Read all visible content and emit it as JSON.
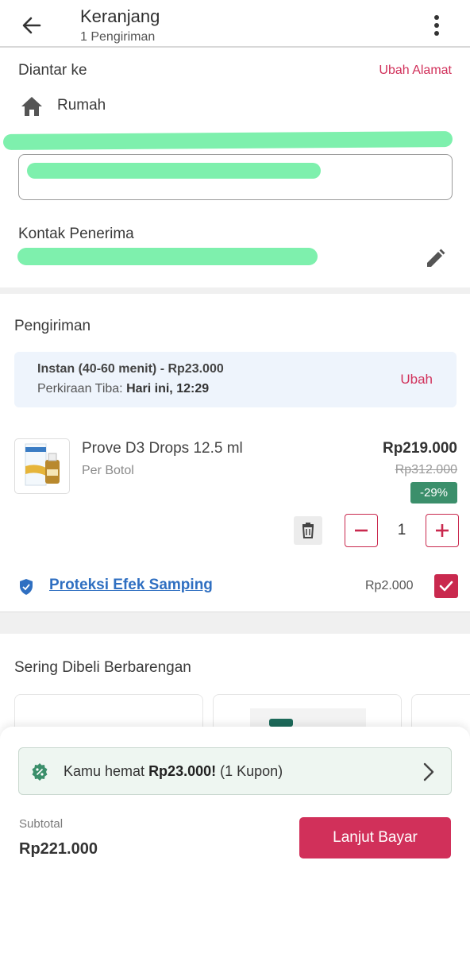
{
  "header": {
    "title": "Keranjang",
    "subtitle": "1 Pengiriman"
  },
  "address": {
    "section_label": "Diantar ke",
    "change_link": "Ubah Alamat",
    "place_label": "Rumah",
    "contact_label": "Kontak Penerima"
  },
  "shipping": {
    "section_label": "Pengiriman",
    "method": "Instan (40-60 menit) - Rp23.000",
    "eta_label": "Perkiraan Tiba:",
    "eta_value": "Hari ini, 12:29",
    "change_label": "Ubah"
  },
  "product": {
    "name": "Prove D3 Drops 12.5 ml",
    "unit": "Per Botol",
    "price": "Rp219.000",
    "old_price": "Rp312.000",
    "discount": "-29%",
    "quantity": "1"
  },
  "protection": {
    "label": "Proteksi Efek Samping",
    "price": "Rp2.000",
    "checked": true
  },
  "bought_together": {
    "section_label": "Sering Dibeli Berbarengan"
  },
  "checkout": {
    "coupon_prefix": "Kamu hemat ",
    "coupon_amount": "Rp23.000!",
    "coupon_suffix": " (1 Kupon)",
    "subtotal_label": "Subtotal",
    "subtotal_value": "Rp221.000",
    "pay_button": "Lanjut Bayar"
  },
  "colors": {
    "accent": "#d1305a",
    "link": "#2f6fc1",
    "discount_badge": "#3b8f6b",
    "redaction": "#7ef0ad"
  },
  "icons": [
    "back-arrow-icon",
    "more-vertical-icon",
    "home-icon",
    "edit-pencil-icon",
    "trash-icon",
    "minus-icon",
    "plus-icon",
    "shield-icon",
    "checkmark-icon",
    "coupon-percent-icon",
    "chevron-right-icon"
  ]
}
